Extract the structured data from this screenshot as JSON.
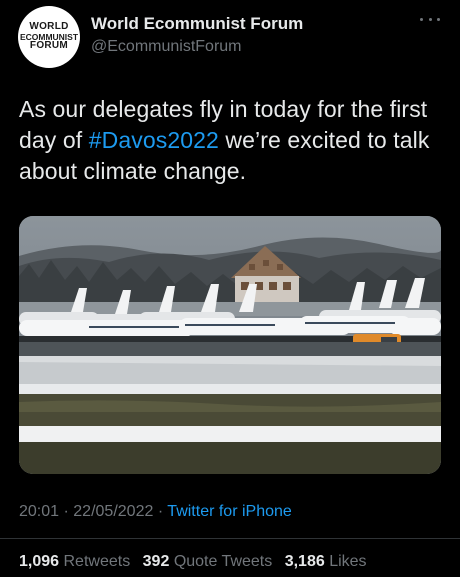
{
  "account": {
    "avatar_line1": "WORLD",
    "avatar_line2": "ECOMMUNIST",
    "avatar_line3": "FORUM",
    "display_name": "World Ecommunist Forum",
    "handle": "@EcommunistForum"
  },
  "tweet": {
    "text_before": "As our delegates fly in today for the first day of ",
    "hashtag": "#Davos2022",
    "text_after": " we’re excited to talk about climate change.",
    "time": "20:01",
    "separator": "·",
    "date": "22/05/2022",
    "source": "Twitter for iPhone"
  },
  "stats": {
    "retweets_count": "1,096",
    "retweets_label": "Retweets",
    "quotes_count": "392",
    "quotes_label": "Quote Tweets",
    "likes_count": "3,186",
    "likes_label": "Likes"
  },
  "media": {
    "description_icon": "photo-airfield-private-jets"
  },
  "colors": {
    "background": "#000000",
    "text": "#e7e9ea",
    "secondary": "#71767b",
    "accent": "#1d9bf0"
  }
}
